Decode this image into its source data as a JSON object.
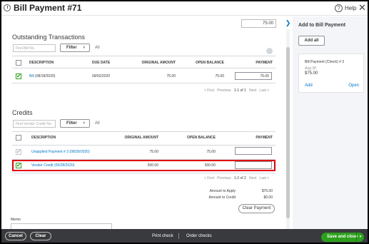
{
  "header": {
    "title": "Bill Payment #71",
    "help_label": "Help",
    "close_glyph": "✕",
    "help_glyph": "?"
  },
  "top_amount_value": "75.00",
  "outstanding": {
    "title": "Outstanding Transactions",
    "find_placeholder": "Find Bill No.",
    "filter_label": "Filter",
    "all_label": "All",
    "columns": [
      "DESCRIPTION",
      "DUE DATE",
      "ORIGINAL AMOUNT",
      "OPEN BALANCE",
      "PAYMENT"
    ],
    "rows": [
      {
        "description_link": "Bill",
        "description_rest": " (08/18/2020)",
        "due_date": "09/02/2020",
        "original_amount": "75.00",
        "open_balance": "75.00",
        "payment": "75.00",
        "checked": true
      }
    ],
    "pager": {
      "first": "< First",
      "previous": "Previous",
      "range": "1-1 of 1",
      "next": "Next",
      "last": "Last >"
    }
  },
  "credits": {
    "title": "Credits",
    "find_placeholder": "Find Vendor Credit No.",
    "filter_label": "Filter",
    "all_label": "All",
    "columns": [
      "DESCRIPTION",
      "ORIGINAL AMOUNT",
      "OPEN BALANCE",
      "PAYMENT"
    ],
    "rows": [
      {
        "description_link": "Unapplied Payment # 3",
        "description_rest": " (08/30/2020)",
        "original_amount": "75.00",
        "open_balance": "75.00",
        "payment": "",
        "checked": true,
        "disabled": true
      },
      {
        "description_link": "Vendor Credit",
        "description_rest": " (09/28/2020)",
        "original_amount": "500.00",
        "open_balance": "500.00",
        "payment": "",
        "checked": true,
        "disabled": false
      }
    ],
    "pager": {
      "first": "< First",
      "previous": "Previous",
      "range": "1-2 of 2",
      "next": "Next",
      "last": "Last >"
    }
  },
  "totals": {
    "apply_label": "Amount to Apply",
    "apply_value": "$75.00",
    "credit_label": "Amount to Credit",
    "credit_value": "$0.00",
    "clear_label": "Clear Payment"
  },
  "memo_label": "Memo",
  "side_panel": {
    "title": "Add to Bill Payment",
    "add_all_label": "Add all",
    "card": {
      "title": "Bill Payment (Check) # 3",
      "date": "Aug 30",
      "amount": "$75.00",
      "add_label": "Add",
      "open_label": "Open"
    },
    "collapse_glyph": "❯"
  },
  "footer": {
    "cancel_label": "Cancel",
    "clear_label": "Clear",
    "print_label": "Print check",
    "order_label": "Order checks",
    "save_label": "Save and close",
    "save_dropdown_glyph": "▾"
  }
}
